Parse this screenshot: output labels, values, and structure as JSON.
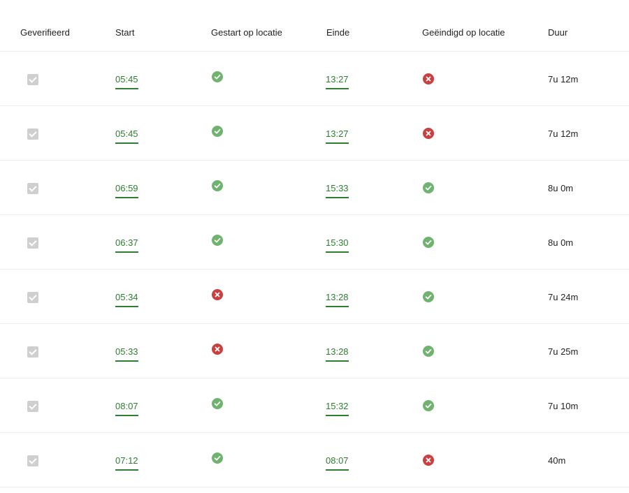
{
  "columns": {
    "verified": "Geverifieerd",
    "start": "Start",
    "started_at_location": "Gestart op locatie",
    "end": "Einde",
    "ended_at_location": "Geëindigd op locatie",
    "duration": "Duur"
  },
  "colors": {
    "accent": "#2e7d32",
    "success": "#6fb36f",
    "error": "#c94040",
    "checkbox": "#cfcfcf"
  },
  "icons": {
    "ok": "check-circle-icon",
    "fail": "x-circle-icon",
    "verified": "checkbox-checked-icon"
  },
  "rows": [
    {
      "verified": true,
      "start": "05:45",
      "started_at_location": false,
      "end": "13:27",
      "ended_at_location": false,
      "duration": "7u 12m"
    },
    {
      "verified": true,
      "start": "05:45",
      "started_at_location": true,
      "end": "13:27",
      "ended_at_location": false,
      "duration": "7u 12m"
    },
    {
      "verified": true,
      "start": "06:59",
      "started_at_location": true,
      "end": "15:33",
      "ended_at_location": true,
      "duration": "8u 0m"
    },
    {
      "verified": true,
      "start": "06:37",
      "started_at_location": true,
      "end": "15:30",
      "ended_at_location": true,
      "duration": "8u 0m"
    },
    {
      "verified": true,
      "start": "05:34",
      "started_at_location": false,
      "end": "13:28",
      "ended_at_location": true,
      "duration": "7u 24m"
    },
    {
      "verified": true,
      "start": "05:33",
      "started_at_location": false,
      "end": "13:28",
      "ended_at_location": true,
      "duration": "7u 25m"
    },
    {
      "verified": true,
      "start": "08:07",
      "started_at_location": true,
      "end": "15:32",
      "ended_at_location": true,
      "duration": "7u 10m"
    },
    {
      "verified": true,
      "start": "07:12",
      "started_at_location": true,
      "end": "08:07",
      "ended_at_location": false,
      "duration": "40m"
    }
  ]
}
